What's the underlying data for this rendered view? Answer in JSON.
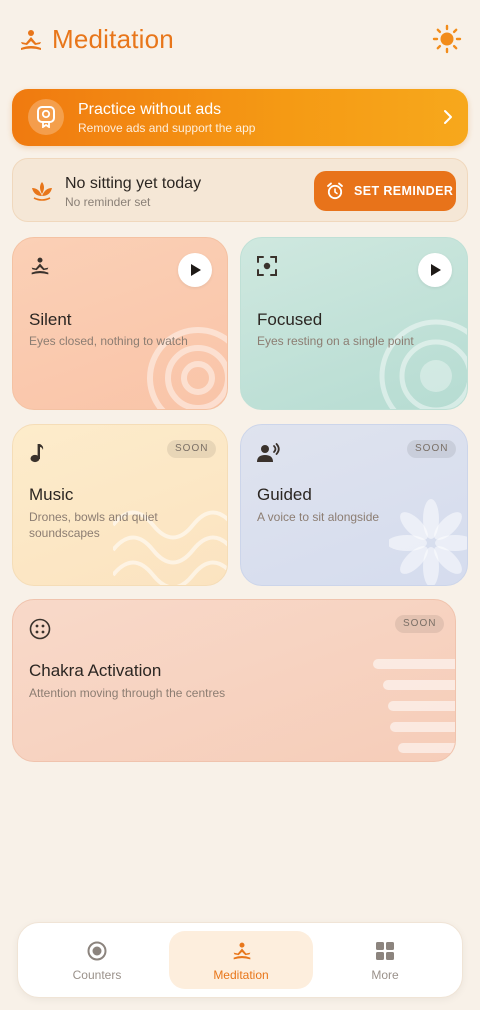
{
  "header": {
    "title": "Meditation",
    "logo_icon": "meditation-pose-icon",
    "theme_icon": "sun-icon"
  },
  "promo": {
    "title": "Practice without ads",
    "subtitle": "Remove ads and support the app",
    "icon": "award-badge-icon"
  },
  "reminder": {
    "title": "No sitting yet today",
    "subtitle": "No reminder set",
    "button_label": "SET REMINDER",
    "icon": "lotus-icon"
  },
  "cards": {
    "silent": {
      "title": "Silent",
      "desc": "Eyes closed, nothing to watch",
      "icon": "meditation-pose-icon"
    },
    "focused": {
      "title": "Focused",
      "desc": "Eyes resting on a single point",
      "icon": "focus-frame-icon"
    },
    "music": {
      "title": "Music",
      "desc": "Drones, bowls and quiet soundscapes",
      "badge": "SOON",
      "icon": "music-note-icon"
    },
    "guided": {
      "title": "Guided",
      "desc": "A voice to sit alongside",
      "badge": "SOON",
      "icon": "voice-person-icon"
    },
    "chakra": {
      "title": "Chakra Activation",
      "desc": "Attention moving through the centres",
      "badge": "SOON",
      "icon": "chakra-dots-icon"
    }
  },
  "nav": {
    "items": [
      {
        "label": "Counters",
        "icon": "record-circle-icon",
        "active": false
      },
      {
        "label": "Meditation",
        "icon": "meditation-pose-icon",
        "active": true
      },
      {
        "label": "More",
        "icon": "grid-icon",
        "active": false
      }
    ]
  },
  "colors": {
    "accent": "#e8761a",
    "background": "#f8f1e8"
  }
}
